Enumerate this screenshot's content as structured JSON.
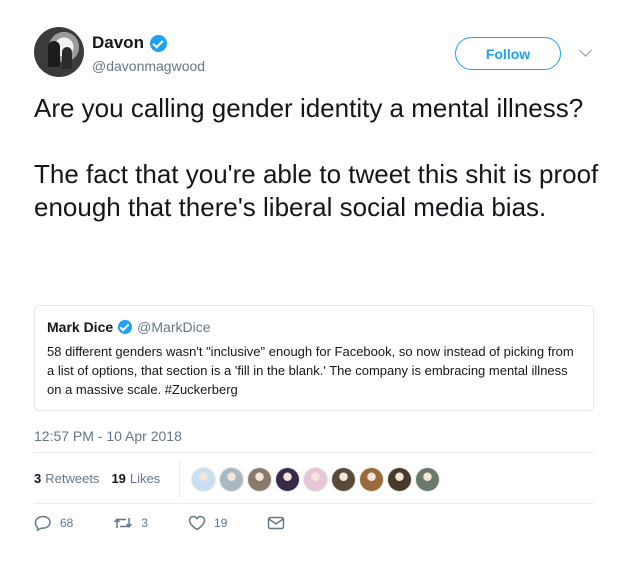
{
  "author": {
    "display_name": "Davon",
    "handle": "@davonmagwood",
    "verified_icon": "verified-badge-icon"
  },
  "follow_label": "Follow",
  "tweet": {
    "paragraphs": [
      "Are you calling gender identity a mental illness?",
      "The fact that you're able to tweet this shit is proof enough that there's liberal social media bias."
    ]
  },
  "quote": {
    "name": "Mark Dice",
    "handle": "@MarkDice",
    "text": "58 different genders wasn't \"inclusive\" enough for Facebook, so now instead of picking from a list of options, that section is a 'fill in the blank.'  The company is embracing mental illness on a massive scale.  #Zuckerberg"
  },
  "timestamp": "12:57 PM - 10 Apr 2018",
  "stats": {
    "retweets_count": "3",
    "retweets_label": "Retweets",
    "likes_count": "19",
    "likes_label": "Likes"
  },
  "likers": [
    {
      "color": "#c9dff2"
    },
    {
      "color": "#aab8c2"
    },
    {
      "color": "#8a7a6a"
    },
    {
      "color": "#3a2a4a"
    },
    {
      "color": "#e8c6d8"
    },
    {
      "color": "#5a4a3a"
    },
    {
      "color": "#9a6a3a"
    },
    {
      "color": "#4a3a2a"
    },
    {
      "color": "#6a7a6a"
    }
  ],
  "actions": {
    "reply_count": "68",
    "retweet_count": "3",
    "like_count": "19"
  },
  "colors": {
    "accent": "#1da1f2",
    "text": "#14171a",
    "secondary": "#657786"
  }
}
